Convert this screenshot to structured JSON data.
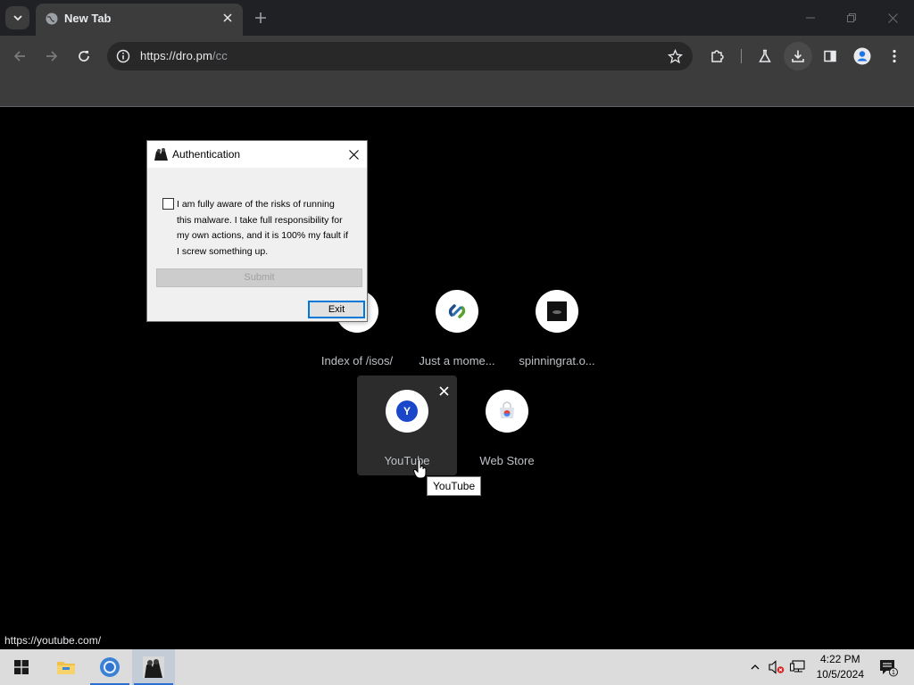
{
  "browser": {
    "tab_title": "New Tab",
    "url_host": "https://dro.pm",
    "url_path": "/cc"
  },
  "shortcuts": [
    {
      "label": "Index of /isos/",
      "icon": "globe-icon"
    },
    {
      "label": "Just a mome...",
      "icon": "link-icon"
    },
    {
      "label": "spinningrat.o...",
      "icon": "rat-thumbnail-icon"
    },
    {
      "label": "YouTube",
      "icon": "letter-y-icon",
      "letter": "Y"
    },
    {
      "label": "Web Store",
      "icon": "web-store-icon"
    }
  ],
  "tooltip": "YouTube",
  "status_url": "https://youtube.com/",
  "dialog": {
    "title": "Authentication",
    "agreement_text": "I am fully aware of the risks of running this malware. I take full responsibility for my own actions, and it is 100% my fault if I screw something up.",
    "checkbox_checked": false,
    "submit_label": "Submit",
    "submit_enabled": false,
    "exit_label": "Exit"
  },
  "taskbar": {
    "time": "4:22 PM",
    "date": "10/5/2024",
    "notification_count": "1",
    "apps": [
      "windows-start-icon",
      "file-explorer-icon",
      "chrome-icon",
      "malware-app-icon"
    ]
  },
  "colors": {
    "chrome_dark": "#202124",
    "toolbar": "#3c3c3c",
    "accent_blue": "#2b6fd1",
    "ntp_bg": "#000000"
  }
}
